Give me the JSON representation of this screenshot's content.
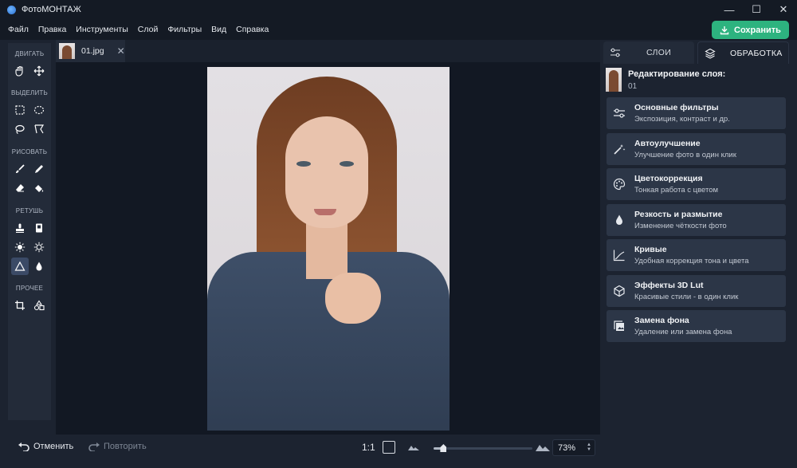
{
  "app": {
    "title": "ФотоМОНТАЖ"
  },
  "window_controls": {
    "minimize": "—",
    "maximize": "☐",
    "close": "✕"
  },
  "menu": [
    "Файл",
    "Правка",
    "Инструменты",
    "Слой",
    "Фильтры",
    "Вид",
    "Справка"
  ],
  "save_button": {
    "label": "Сохранить"
  },
  "toolbar": {
    "sections": {
      "move": "ДВИГАТЬ",
      "select": "ВЫДЕЛИТЬ",
      "draw": "РИСОВАТЬ",
      "retouch": "РЕТУШЬ",
      "other": "ПРОЧЕЕ"
    }
  },
  "document_tab": {
    "name": "01.jpg",
    "close": "✕"
  },
  "bottom": {
    "undo": "Отменить",
    "redo": "Повторить",
    "ratio": "1:1",
    "zoom": "73%",
    "zoom_level": 0.1
  },
  "right_panel": {
    "tabs": {
      "layers": "СЛОИ",
      "processing": "ОБРАБОТКА"
    },
    "layer": {
      "title": "Редактирование слоя:",
      "name": "01"
    },
    "items": [
      {
        "title": "Основные фильтры",
        "subtitle": "Экспозиция, контраст и др.",
        "icon": "sliders-icon"
      },
      {
        "title": "Автоулучшение",
        "subtitle": "Улучшение фото в один клик",
        "icon": "magic-wand-icon"
      },
      {
        "title": "Цветокоррекция",
        "subtitle": "Тонкая работа с цветом",
        "icon": "palette-icon"
      },
      {
        "title": "Резкость и размытие",
        "subtitle": "Изменение чёткости фото",
        "icon": "drop-icon"
      },
      {
        "title": "Кривые",
        "subtitle": "Удобная коррекция тона и цвета",
        "icon": "curves-icon"
      },
      {
        "title": "Эффекты 3D Lut",
        "subtitle": "Красивые стили - в один клик",
        "icon": "cube-icon"
      },
      {
        "title": "Замена фона",
        "subtitle": "Удаление или замена фона",
        "icon": "layers-stack-icon"
      }
    ]
  },
  "colors": {
    "accent": "#2db37f",
    "panel": "#232b39",
    "card": "#2c3647"
  }
}
